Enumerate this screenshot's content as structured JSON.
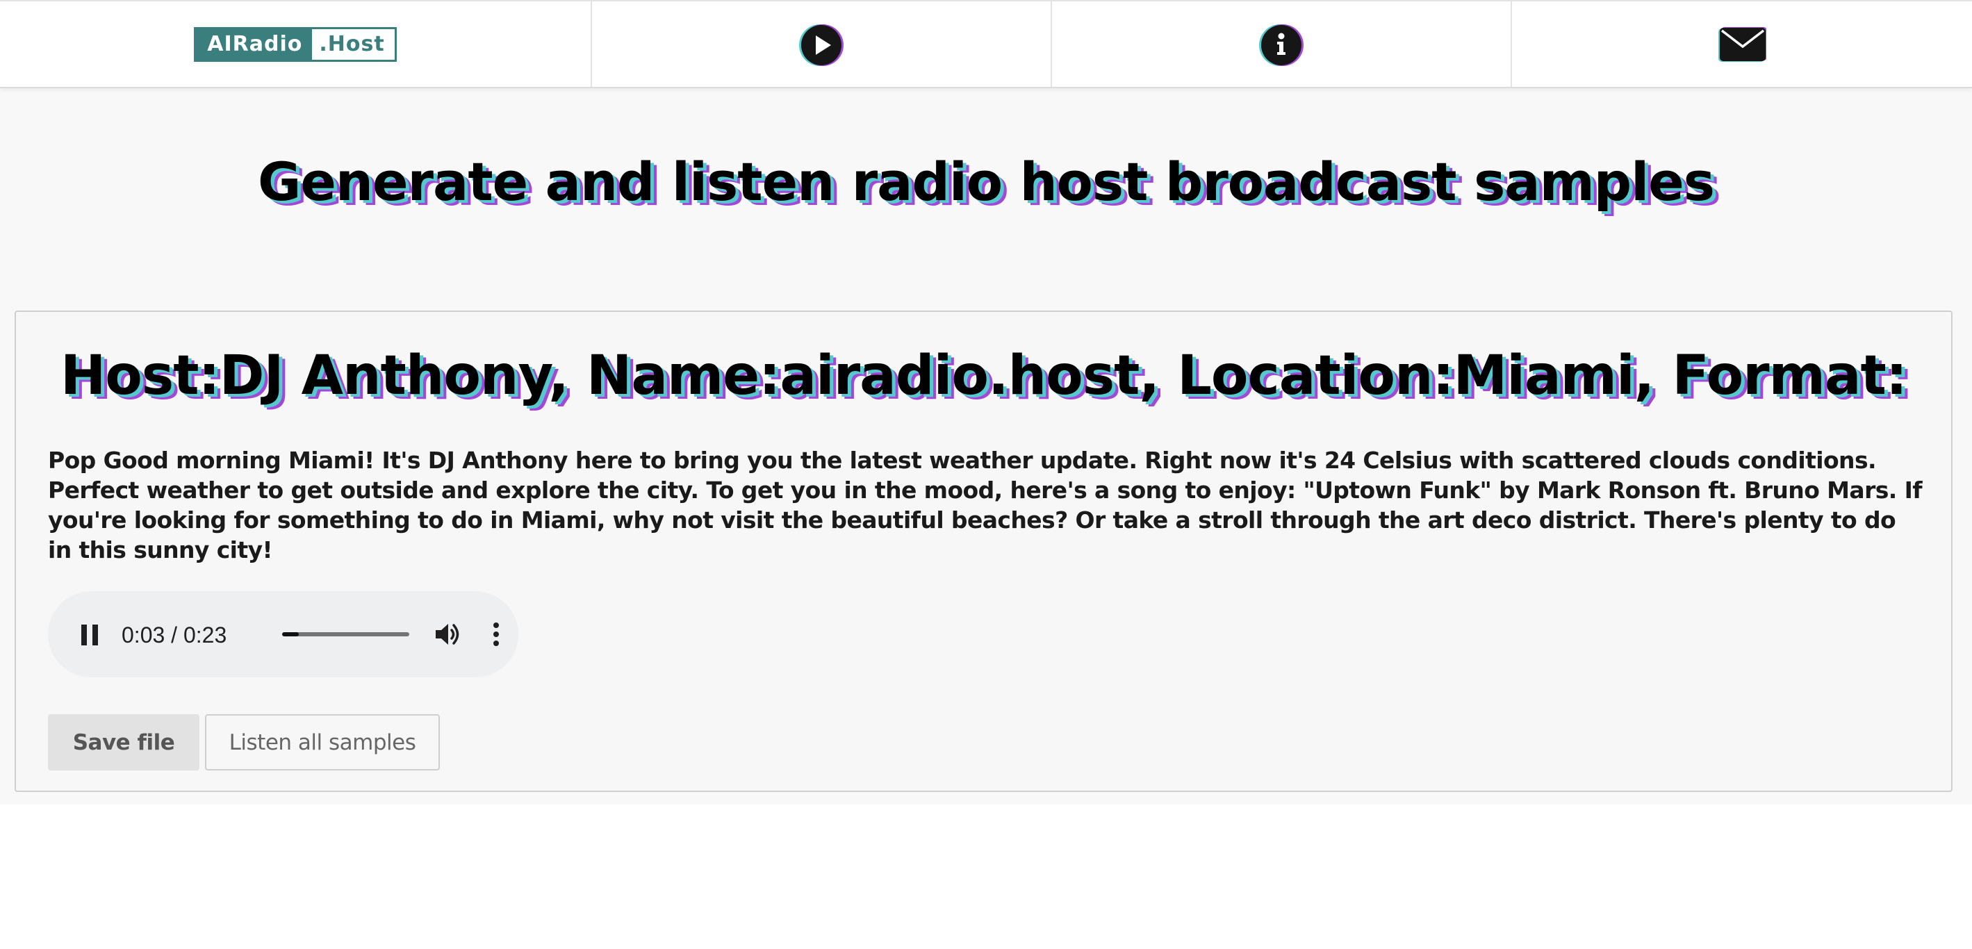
{
  "nav": {
    "logo_left": "AIRadio",
    "logo_right": ".Host",
    "items": [
      {
        "icon": "play-circle-icon"
      },
      {
        "icon": "info-circle-icon"
      },
      {
        "icon": "envelope-icon"
      }
    ]
  },
  "page": {
    "title": "Generate and listen radio host broadcast samples"
  },
  "sample": {
    "title": "Host:DJ Anthony, Name:airadio.host, Location:Miami, Format:",
    "text": "Pop Good morning Miami! It's DJ Anthony here to bring you the latest weather update. Right now it's 24 Celsius with scattered clouds conditions. Perfect weather to get outside and explore the city. To get you in the mood, here's a song to enjoy: \"Uptown Funk\" by Mark Ronson ft. Bruno Mars. If you're looking for something to do in Miami, why not visit the beautiful beaches? Or take a stroll through the art deco district. There's plenty to do in this sunny city!",
    "player": {
      "time": "0:03 / 0:23",
      "progress_fraction": 0.13
    },
    "buttons": {
      "save": "Save file",
      "listen_all": "Listen all samples"
    }
  },
  "colors": {
    "brand_teal": "#3a7e7e",
    "shadow_cyan": "#56c9cf",
    "shadow_purple": "#a247d8"
  }
}
